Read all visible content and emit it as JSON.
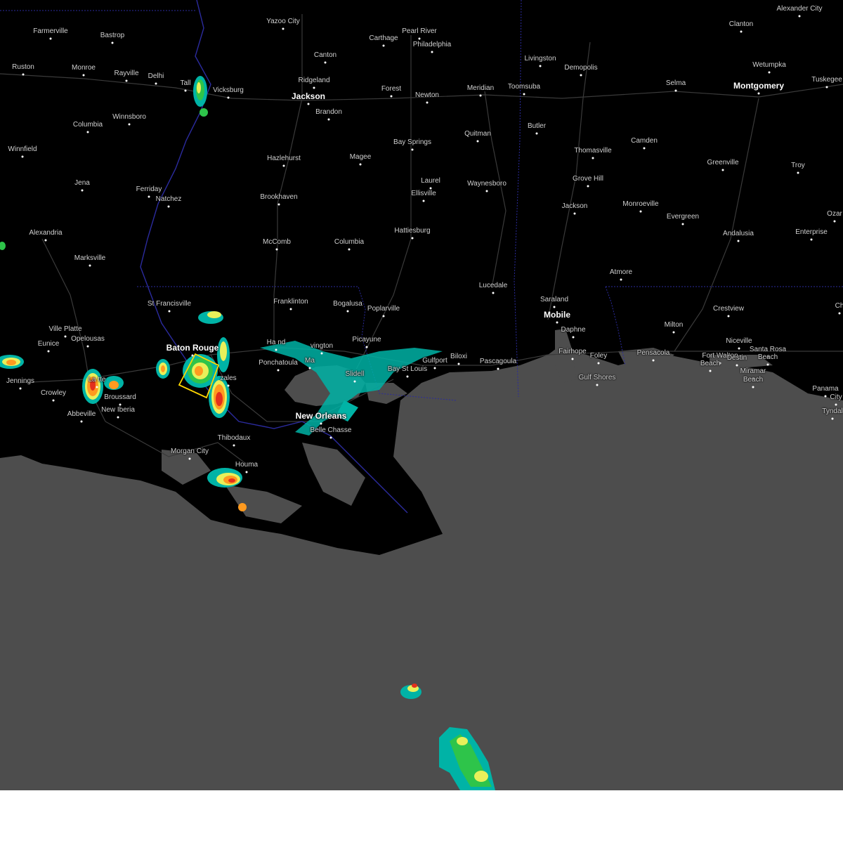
{
  "map": {
    "colors": {
      "land": "#000000",
      "water": "#4d4d4d",
      "roads": "#3a3a3a",
      "state_line": "#2b2b9e",
      "warning_box": "#ffd700"
    },
    "radar_colors": [
      "#00b3a6",
      "#2ec44a",
      "#e8f05a",
      "#ff9a1f",
      "#e3301c"
    ],
    "cities": [
      {
        "id": "farmerville",
        "name": "Farmerville",
        "major": false
      },
      {
        "id": "bastrop",
        "name": "Bastrop",
        "major": false
      },
      {
        "id": "yazoo-city",
        "name": "Yazoo City",
        "major": false
      },
      {
        "id": "carthage",
        "name": "Carthage",
        "major": false
      },
      {
        "id": "pearl-river",
        "name": "Pearl River",
        "major": false
      },
      {
        "id": "philadelphia",
        "name": "Philadelphia",
        "major": false
      },
      {
        "id": "clanton",
        "name": "Clanton",
        "major": false
      },
      {
        "id": "alexander-city",
        "name": "Alexander City",
        "major": false
      },
      {
        "id": "ruston",
        "name": "Ruston",
        "major": false
      },
      {
        "id": "monroe",
        "name": "Monroe",
        "major": false
      },
      {
        "id": "rayville",
        "name": "Rayville",
        "major": false
      },
      {
        "id": "delhi",
        "name": "Delhi",
        "major": false
      },
      {
        "id": "tallulah",
        "name": "Tall",
        "major": false
      },
      {
        "id": "vicksburg",
        "name": "Vicksburg",
        "major": false
      },
      {
        "id": "canton",
        "name": "Canton",
        "major": false
      },
      {
        "id": "ridgeland",
        "name": "Ridgeland",
        "major": false
      },
      {
        "id": "jackson-ms",
        "name": "Jackson",
        "major": true
      },
      {
        "id": "brandon",
        "name": "Brandon",
        "major": false
      },
      {
        "id": "forest",
        "name": "Forest",
        "major": false
      },
      {
        "id": "newton",
        "name": "Newton",
        "major": false
      },
      {
        "id": "meridian",
        "name": "Meridian",
        "major": false
      },
      {
        "id": "toomsuba",
        "name": "Toomsuba",
        "major": false
      },
      {
        "id": "livingston",
        "name": "Livingston",
        "major": false
      },
      {
        "id": "demopolis",
        "name": "Demopolis",
        "major": false
      },
      {
        "id": "selma",
        "name": "Selma",
        "major": false
      },
      {
        "id": "montgomery",
        "name": "Montgomery",
        "major": true
      },
      {
        "id": "wetumpka",
        "name": "Wetumpka",
        "major": false
      },
      {
        "id": "tuskegee",
        "name": "Tuskegee",
        "major": false
      },
      {
        "id": "columbia-la",
        "name": "Columbia",
        "major": false
      },
      {
        "id": "winnsboro",
        "name": "Winnsboro",
        "major": false
      },
      {
        "id": "butler",
        "name": "Butler",
        "major": false
      },
      {
        "id": "quitman",
        "name": "Quitman",
        "major": false
      },
      {
        "id": "bay-springs",
        "name": "Bay Springs",
        "major": false
      },
      {
        "id": "thomasville",
        "name": "Thomasville",
        "major": false
      },
      {
        "id": "camden",
        "name": "Camden",
        "major": false
      },
      {
        "id": "winnfield",
        "name": "Winnfield",
        "major": false
      },
      {
        "id": "hazlehurst",
        "name": "Hazlehurst",
        "major": false
      },
      {
        "id": "magee",
        "name": "Magee",
        "major": false
      },
      {
        "id": "greenville",
        "name": "Greenville",
        "major": false
      },
      {
        "id": "troy",
        "name": "Troy",
        "major": false
      },
      {
        "id": "jena",
        "name": "Jena",
        "major": false
      },
      {
        "id": "ferriday",
        "name": "Ferriday",
        "major": false
      },
      {
        "id": "natchez",
        "name": "Natchez",
        "major": false
      },
      {
        "id": "laurel",
        "name": "Laurel",
        "major": false
      },
      {
        "id": "waynesboro",
        "name": "Waynesboro",
        "major": false
      },
      {
        "id": "grove-hill",
        "name": "Grove Hill",
        "major": false
      },
      {
        "id": "brookhaven",
        "name": "Brookhaven",
        "major": false
      },
      {
        "id": "ellisville",
        "name": "Ellisville",
        "major": false
      },
      {
        "id": "jackson-al",
        "name": "Jackson",
        "major": false
      },
      {
        "id": "monroeville",
        "name": "Monroeville",
        "major": false
      },
      {
        "id": "evergreen",
        "name": "Evergreen",
        "major": false
      },
      {
        "id": "ozark",
        "name": "Ozar",
        "major": false
      },
      {
        "id": "alexandria",
        "name": "Alexandria",
        "major": false
      },
      {
        "id": "hattiesburg",
        "name": "Hattiesburg",
        "major": false
      },
      {
        "id": "andalusia",
        "name": "Andalusia",
        "major": false
      },
      {
        "id": "enterprise",
        "name": "Enterprise",
        "major": false
      },
      {
        "id": "mccomb",
        "name": "McComb",
        "major": false
      },
      {
        "id": "columbia-ms",
        "name": "Columbia",
        "major": false
      },
      {
        "id": "marksville",
        "name": "Marksville",
        "major": false
      },
      {
        "id": "atmore",
        "name": "Atmore",
        "major": false
      },
      {
        "id": "lucedale",
        "name": "Lucedale",
        "major": false
      },
      {
        "id": "saraland",
        "name": "Saraland",
        "major": false
      },
      {
        "id": "st-francisville",
        "name": "St Francisville",
        "major": false
      },
      {
        "id": "franklinton",
        "name": "Franklinton",
        "major": false
      },
      {
        "id": "bogalusa",
        "name": "Bogalusa",
        "major": false
      },
      {
        "id": "poplarville",
        "name": "Poplarville",
        "major": false
      },
      {
        "id": "crestview",
        "name": "Crestview",
        "major": false
      },
      {
        "id": "chipley",
        "name": "Ch",
        "major": false
      },
      {
        "id": "mobile",
        "name": "Mobile",
        "major": true
      },
      {
        "id": "ville-platte",
        "name": "Ville Platte",
        "major": false
      },
      {
        "id": "milton",
        "name": "Milton",
        "major": false
      },
      {
        "id": "daphne",
        "name": "Daphne",
        "major": false
      },
      {
        "id": "opelousas",
        "name": "Opelousas",
        "major": false
      },
      {
        "id": "picayune",
        "name": "Picayune",
        "major": false
      },
      {
        "id": "niceville",
        "name": "Niceville",
        "major": false
      },
      {
        "id": "eunice",
        "name": "Eunice",
        "major": false
      },
      {
        "id": "baton-rouge",
        "name": "Baton Rouge",
        "major": true
      },
      {
        "id": "hammond",
        "name": "Ha         nd",
        "major": false
      },
      {
        "id": "covington",
        "name": "vington",
        "major": false
      },
      {
        "id": "fairhope",
        "name": "Fairhope",
        "major": false
      },
      {
        "id": "foley",
        "name": "Foley",
        "major": false
      },
      {
        "id": "pensacola",
        "name": "Pensacola",
        "major": false
      },
      {
        "id": "santa-rosa-beach",
        "name": "Santa Rosa",
        "major": false
      },
      {
        "id": "santa-rosa-beach-2",
        "name": "Beach",
        "major": false
      },
      {
        "id": "fort-walton-beach",
        "name": "Fort Walton",
        "major": false
      },
      {
        "id": "fort-walton-beach-2",
        "name": "Beach",
        "major": false
      },
      {
        "id": "destin",
        "name": "Destin",
        "major": false
      },
      {
        "id": "ponchatoula",
        "name": "Ponchatoula",
        "major": false
      },
      {
        "id": "mandeville",
        "name": "Ma",
        "major": false
      },
      {
        "id": "gulfport",
        "name": "Gulfport",
        "major": false
      },
      {
        "id": "biloxi",
        "name": "Biloxi",
        "major": false
      },
      {
        "id": "pascagoula",
        "name": "Pascagoula",
        "major": false
      },
      {
        "id": "jennings",
        "name": "Jennings",
        "major": false
      },
      {
        "id": "lafayette",
        "name": "La       tte",
        "major": false
      },
      {
        "id": "gonzales",
        "name": "  zales",
        "major": false
      },
      {
        "id": "slidell",
        "name": "Slidell",
        "major": false
      },
      {
        "id": "bay-st-louis",
        "name": "Bay St Louis",
        "major": false
      },
      {
        "id": "gulf-shores",
        "name": "Gulf Shores",
        "major": false
      },
      {
        "id": "miramar-beach",
        "name": "Miramar",
        "major": false
      },
      {
        "id": "miramar-beach-2",
        "name": "Beach",
        "major": false
      },
      {
        "id": "crowley",
        "name": "Crowley",
        "major": false
      },
      {
        "id": "broussard",
        "name": "Broussard",
        "major": false
      },
      {
        "id": "panama-city",
        "name": "Panama",
        "major": false
      },
      {
        "id": "panama-city-2",
        "name": "City",
        "major": false
      },
      {
        "id": "abbeville",
        "name": "Abbeville",
        "major": false
      },
      {
        "id": "new-iberia",
        "name": "New Iberia",
        "major": false
      },
      {
        "id": "new-orleans",
        "name": "New Orleans",
        "major": true
      },
      {
        "id": "belle-chasse",
        "name": "Belle Chasse",
        "major": false
      },
      {
        "id": "tyndall",
        "name": "Tyndal",
        "major": false
      },
      {
        "id": "thibodaux",
        "name": "Thibodaux",
        "major": false
      },
      {
        "id": "morgan-city",
        "name": "Morgan City",
        "major": false
      },
      {
        "id": "houma",
        "name": "Houma",
        "major": false
      }
    ]
  }
}
